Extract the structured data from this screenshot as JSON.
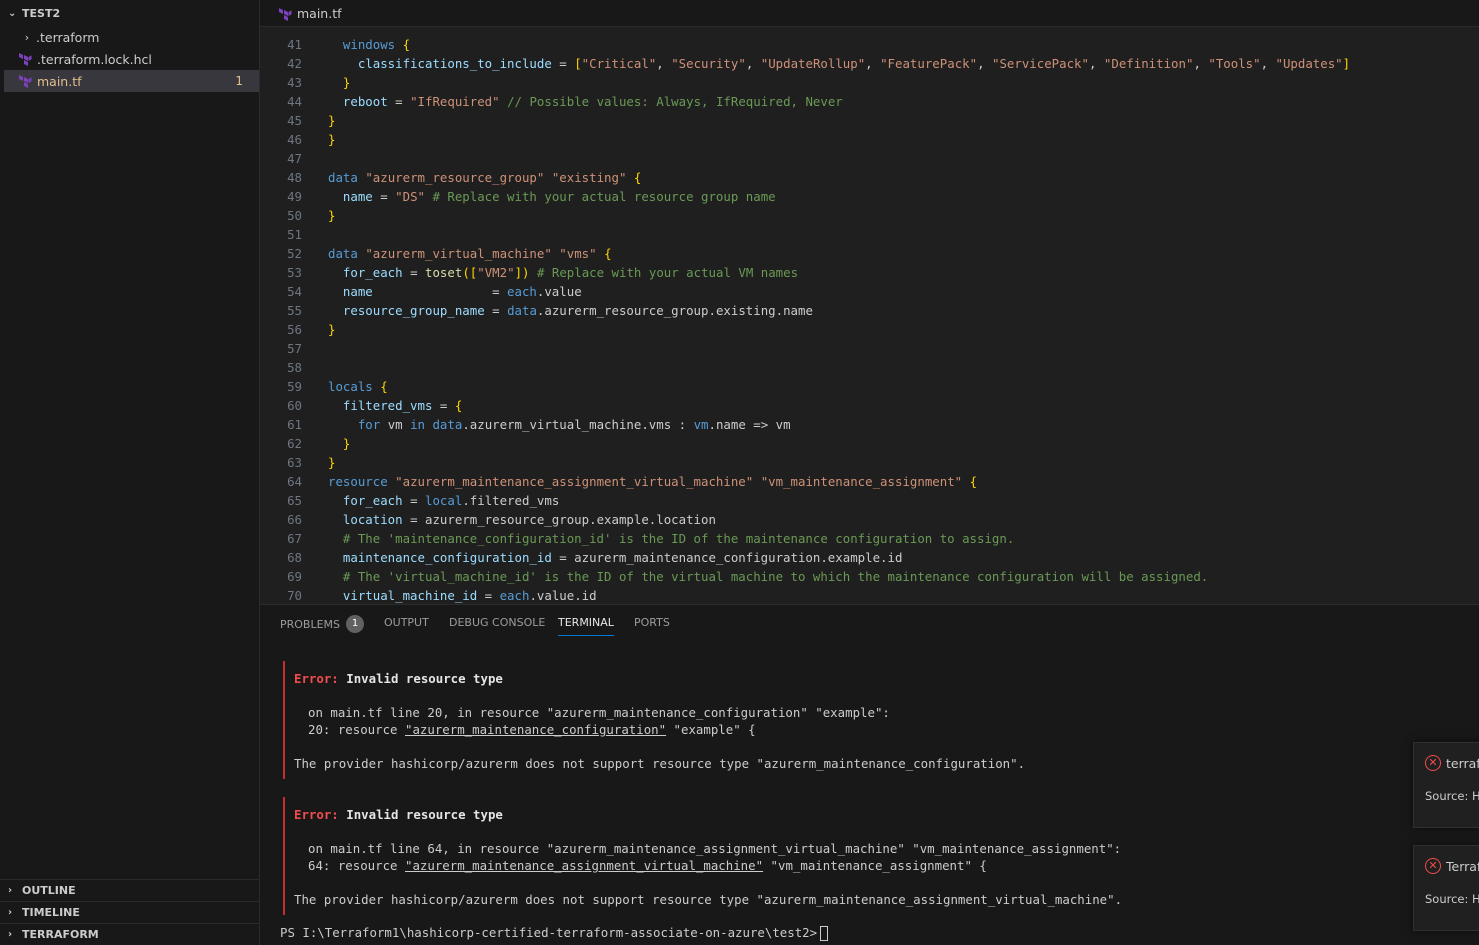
{
  "explorer": {
    "root_label": "TEST2",
    "items": [
      {
        "label": ".terraform",
        "type": "folder"
      },
      {
        "label": ".terraform.lock.hcl",
        "type": "file"
      },
      {
        "label": "main.tf",
        "type": "file",
        "problems": "1"
      }
    ],
    "sections": [
      "OUTLINE",
      "TIMELINE",
      "TERRAFORM"
    ]
  },
  "editor": {
    "tab_label": "main.tf",
    "lines": [
      {
        "n": "41",
        "t": "  windows {"
      },
      {
        "n": "42",
        "t": "    classifications_to_include = [\"Critical\", \"Security\", \"UpdateRollup\", \"FeaturePack\", \"ServicePack\", \"Definition\", \"Tools\", \"Updates\"]"
      },
      {
        "n": "43",
        "t": "  }"
      },
      {
        "n": "44",
        "t": "  reboot = \"IfRequired\" // Possible values: Always, IfRequired, Never"
      },
      {
        "n": "45",
        "t": "}"
      },
      {
        "n": "46",
        "t": "}"
      },
      {
        "n": "47",
        "t": ""
      },
      {
        "n": "48",
        "t": "data \"azurerm_resource_group\" \"existing\" {"
      },
      {
        "n": "49",
        "t": "  name = \"DS\" # Replace with your actual resource group name"
      },
      {
        "n": "50",
        "t": "}"
      },
      {
        "n": "51",
        "t": ""
      },
      {
        "n": "52",
        "t": "data \"azurerm_virtual_machine\" \"vms\" {"
      },
      {
        "n": "53",
        "t": "  for_each = toset([\"VM2\"]) # Replace with your actual VM names"
      },
      {
        "n": "54",
        "t": "  name                = each.value"
      },
      {
        "n": "55",
        "t": "  resource_group_name = data.azurerm_resource_group.existing.name"
      },
      {
        "n": "56",
        "t": "}"
      },
      {
        "n": "57",
        "t": ""
      },
      {
        "n": "58",
        "t": ""
      },
      {
        "n": "59",
        "t": "locals {"
      },
      {
        "n": "60",
        "t": "  filtered_vms = {"
      },
      {
        "n": "61",
        "t": "    for vm in data.azurerm_virtual_machine.vms : vm.name => vm"
      },
      {
        "n": "62",
        "t": "  }"
      },
      {
        "n": "63",
        "t": "}"
      },
      {
        "n": "64",
        "t": "resource \"azurerm_maintenance_assignment_virtual_machine\" \"vm_maintenance_assignment\" {"
      },
      {
        "n": "65",
        "t": "  for_each = local.filtered_vms"
      },
      {
        "n": "66",
        "t": "  location = azurerm_resource_group.example.location"
      },
      {
        "n": "67",
        "t": "  # The 'maintenance_configuration_id' is the ID of the maintenance configuration to assign."
      },
      {
        "n": "68",
        "t": "  maintenance_configuration_id = azurerm_maintenance_configuration.example.id"
      },
      {
        "n": "69",
        "t": "  # The 'virtual_machine_id' is the ID of the virtual machine to which the maintenance configuration will be assigned."
      },
      {
        "n": "70",
        "t": "  virtual_machine_id = each.value.id"
      }
    ]
  },
  "panel": {
    "tabs": [
      "PROBLEMS",
      "OUTPUT",
      "DEBUG CONSOLE",
      "TERMINAL",
      "PORTS"
    ],
    "problems_count": "1",
    "active_tab": "TERMINAL",
    "errors": [
      {
        "label": "Error:",
        "title": "Invalid resource type",
        "location": "on main.tf line 20, in resource \"azurerm_maintenance_configuration\" \"example\":",
        "code_prefix": "20: resource ",
        "code_type": "\"azurerm_maintenance_configuration\"",
        "code_suffix": " \"example\" {",
        "message": "The provider hashicorp/azurerm does not support resource type \"azurerm_maintenance_configuration\"."
      },
      {
        "label": "Error:",
        "title": "Invalid resource type",
        "location": "on main.tf line 64, in resource \"azurerm_maintenance_assignment_virtual_machine\" \"vm_maintenance_assignment\":",
        "code_prefix": "64: resource ",
        "code_type": "\"azurerm_maintenance_assignment_virtual_machine\"",
        "code_suffix": " \"vm_maintenance_assignment\" {",
        "message": "The provider hashicorp/azurerm does not support resource type \"azurerm_maintenance_assignment_virtual_machine\"."
      }
    ],
    "prompt": "PS I:\\Terraform1\\hashicorp-certified-terraform-associate-on-azure\\test2>"
  },
  "notifications": [
    {
      "title": "terrafo",
      "source": "Source: Ha",
      "icon": "error-icon"
    },
    {
      "title": "Terrafo",
      "source": "Source: Ha",
      "icon": "error-icon"
    }
  ],
  "colors": {
    "accent": "#0078d4",
    "error": "#f14c4c",
    "modified": "#e2c08d",
    "terraform_purple": "#7b42bc"
  }
}
